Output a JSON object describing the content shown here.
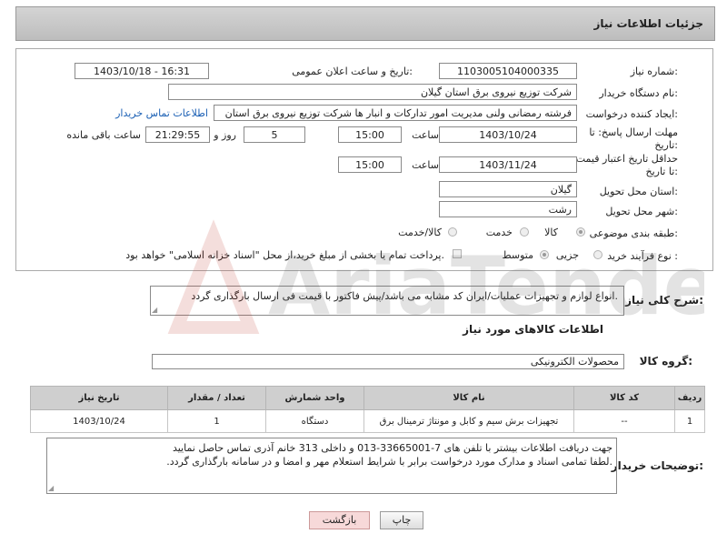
{
  "header": {
    "title": "جزئیات اطلاعات نیاز"
  },
  "form": {
    "need_number_label": "شماره نیاز:",
    "need_number": "1103005104000335",
    "announce_label": "تاریخ و ساعت اعلان عمومی:",
    "announce_value": "1403/10/18 - 16:31",
    "buyer_org_label": "نام دستگاه خریدار:",
    "buyer_org": "شرکت توزیع نیروی برق استان گیلان",
    "creator_label": "ایجاد کننده درخواست:",
    "creator": "فرشته رمضانی ولنی مدیریت امور تدارکات و انبار ها شرکت توزیع نیروی برق استان",
    "contact_link": "اطلاعات تماس خریدار",
    "deadline_label": "مهلت ارسال پاسخ: تا تاریخ:",
    "deadline_date": "1403/10/24",
    "time_label": "ساعت",
    "deadline_time": "15:00",
    "days": "5",
    "days_label": "روز و",
    "remaining": "21:29:55",
    "remaining_label": "ساعت باقی مانده",
    "validity_label": "حداقل تاریخ اعتبار قیمت: تا تاریخ:",
    "validity_date": "1403/11/24",
    "validity_time": "15:00",
    "province_label": "استان محل تحویل:",
    "province": "گیلان",
    "city_label": "شهر محل تحویل:",
    "city": "رشت",
    "category_label": "طبقه بندی موضوعی:",
    "category_options": [
      "کالا",
      "خدمت",
      "کالا/خدمت"
    ],
    "process_label": "نوع فرآیند خرید :",
    "process_options": [
      "جزیی",
      "متوسط"
    ],
    "payment_note": "پرداخت تمام یا بخشی از مبلغ خرید،از محل \"اسناد خزانه اسلامی\" خواهد بود."
  },
  "description": {
    "label": "شرح کلی نیاز:",
    "text": "انواع لوازم و تجهیزات عملیات/ایران کد مشابه می باشد/پیش فاکتور با قیمت فی ارسال بارگذاری گردد."
  },
  "goods": {
    "section_title": "اطلاعات کالاهای مورد نیاز",
    "group_label": "گروه کالا:",
    "group_value": "محصولات الکترونیکی",
    "columns": [
      "ردیف",
      "کد کالا",
      "نام کالا",
      "واحد شمارش",
      "تعداد / مقدار",
      "تاریخ نیاز"
    ],
    "rows": [
      [
        "1",
        "--",
        "تجهیزات برش سیم و کابل و مونتاژ ترمینال برق",
        "دستگاه",
        "1",
        "1403/10/24"
      ]
    ]
  },
  "buyer_notes": {
    "label": "توضیحات خریدار:",
    "line1": "جهت دریافت اطلاعات بیشتر با تلفن های 7-33665001-013 و داخلی 313 خانم آذری تماس حاصل نمایید",
    "line2": ".لطفا تمامی اسناد و مدارک مورد درخواست برابر با شرایط استعلام مهر و امضا و در سامانه بارگذاری گردد."
  },
  "buttons": {
    "print": "چاپ",
    "back": "بازگشت"
  },
  "watermark": {
    "text": "AriaTender.net"
  },
  "colors": {
    "link": "#1a5fb4",
    "header_bg": "#c8c8c8",
    "back_button_bg": "#f7d9d9"
  }
}
